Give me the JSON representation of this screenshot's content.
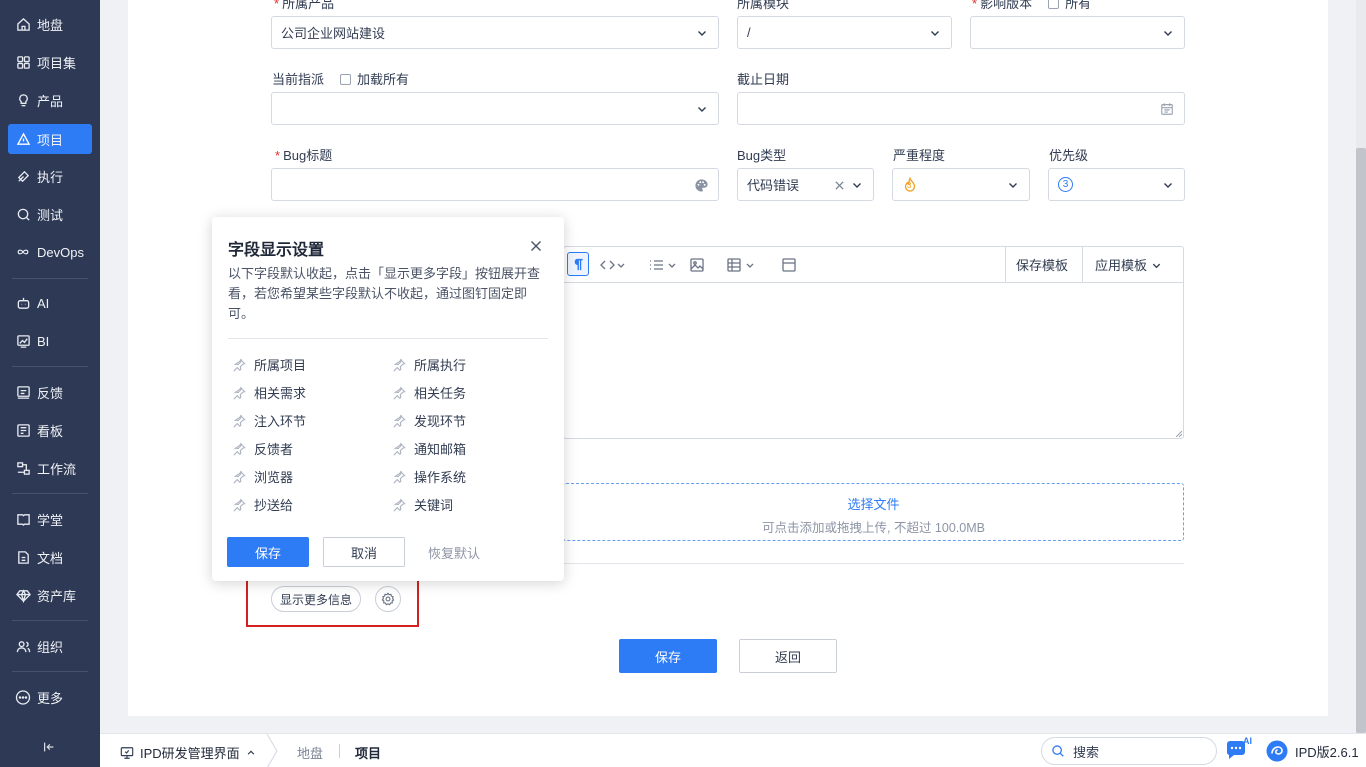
{
  "sidebar": {
    "items": [
      {
        "label": "地盘",
        "icon": "home-icon"
      },
      {
        "label": "项目集",
        "icon": "grid-icon"
      },
      {
        "label": "产品",
        "icon": "lightbulb-icon"
      },
      {
        "label": "项目",
        "icon": "project-icon"
      },
      {
        "label": "执行",
        "icon": "run-icon"
      },
      {
        "label": "测试",
        "icon": "test-icon"
      },
      {
        "label": "DevOps",
        "icon": "infinity-icon"
      },
      {
        "label": "AI",
        "icon": "robot-icon"
      },
      {
        "label": "BI",
        "icon": "bi-chart-icon"
      },
      {
        "label": "反馈",
        "icon": "feedback-icon"
      },
      {
        "label": "看板",
        "icon": "kanban-icon"
      },
      {
        "label": "工作流",
        "icon": "workflow-icon"
      },
      {
        "label": "学堂",
        "icon": "school-icon"
      },
      {
        "label": "文档",
        "icon": "document-icon"
      },
      {
        "label": "资产库",
        "icon": "diamond-icon"
      },
      {
        "label": "组织",
        "icon": "people-icon"
      },
      {
        "label": "更多",
        "icon": "more-icon"
      }
    ],
    "active": "项目"
  },
  "form": {
    "product_label": "所属产品",
    "product_value": "公司企业网站建设",
    "module_label": "所属模块",
    "module_value": "/",
    "version_label": "影响版本",
    "version_all": "所有",
    "assign_label": "当前指派",
    "assign_load_all": "加载所有",
    "deadline_label": "截止日期",
    "title_label": "Bug标题",
    "type_label": "Bug类型",
    "type_value": "代码错误",
    "severity_label": "严重程度",
    "severity_value": "3",
    "priority_label": "优先级",
    "priority_value": "3",
    "save_template": "保存模板",
    "apply_template": "应用模板",
    "upload_title": "选择文件",
    "upload_hint": "可点击添加或拖拽上传, 不超过 100.0MB",
    "show_more": "显示更多信息",
    "save": "保存",
    "back": "返回"
  },
  "popover": {
    "title": "字段显示设置",
    "desc": "以下字段默认收起，点击「显示更多字段」按钮展开查看，若您希望某些字段默认不收起，通过图钉固定即可。",
    "left": [
      "所属项目",
      "相关需求",
      "注入环节",
      "反馈者",
      "浏览器",
      "抄送给"
    ],
    "right": [
      "所属执行",
      "相关任务",
      "发现环节",
      "通知邮箱",
      "操作系统",
      "关键词"
    ],
    "save": "保存",
    "cancel": "取消",
    "reset": "恢复默认"
  },
  "bottombar": {
    "workspace": "IPD研发管理界面",
    "crumb1": "地盘",
    "crumb2": "项目",
    "search_placeholder": "搜索",
    "ai_badge": "AI",
    "version": "IPD版2.6.1"
  },
  "colors": {
    "sidebar_bg": "#2e3a55",
    "accent": "#2e7bf6",
    "highlight_box": "#d42020"
  }
}
